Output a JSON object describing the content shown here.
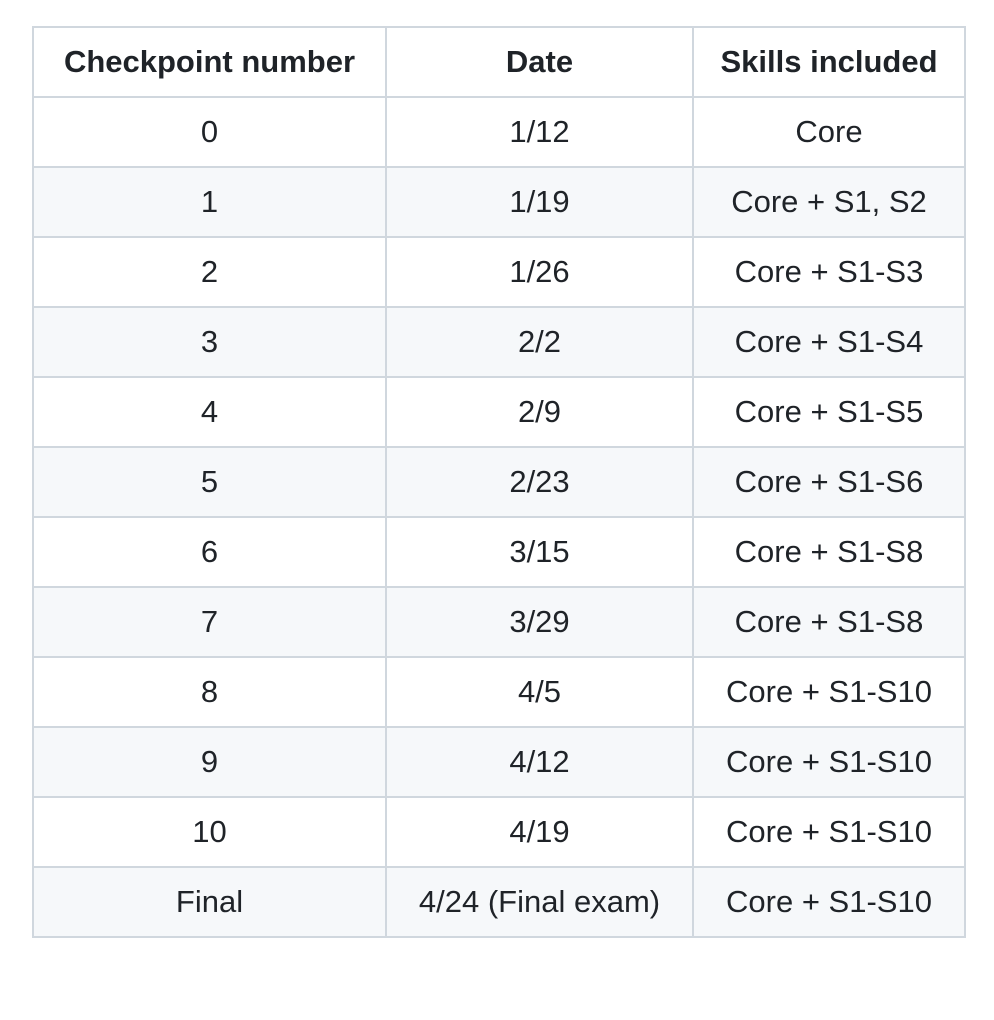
{
  "table": {
    "headers": [
      "Checkpoint number",
      "Date",
      "Skills included"
    ],
    "rows": [
      [
        "0",
        "1/12",
        "Core"
      ],
      [
        "1",
        "1/19",
        "Core + S1, S2"
      ],
      [
        "2",
        "1/26",
        "Core + S1-S3"
      ],
      [
        "3",
        "2/2",
        "Core + S1-S4"
      ],
      [
        "4",
        "2/9",
        "Core + S1-S5"
      ],
      [
        "5",
        "2/23",
        "Core + S1-S6"
      ],
      [
        "6",
        "3/15",
        "Core + S1-S8"
      ],
      [
        "7",
        "3/29",
        "Core + S1-S8"
      ],
      [
        "8",
        "4/5",
        "Core + S1-S10"
      ],
      [
        "9",
        "4/12",
        "Core + S1-S10"
      ],
      [
        "10",
        "4/19",
        "Core + S1-S10"
      ],
      [
        "Final",
        "4/24 (Final exam)",
        "Core + S1-S10"
      ]
    ]
  },
  "colors": {
    "border": "#d0d7de",
    "stripe": "#f6f8fa",
    "text": "#1f2328"
  }
}
